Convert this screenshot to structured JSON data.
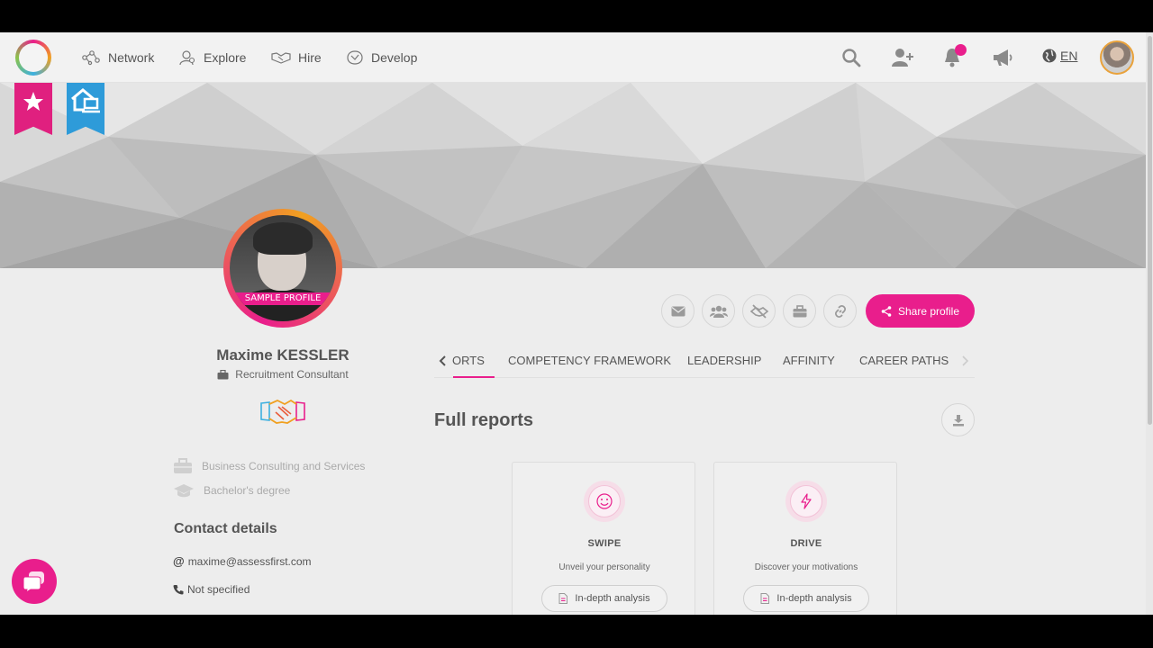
{
  "nav": {
    "items": [
      {
        "label": "Network",
        "icon": "network-icon"
      },
      {
        "label": "Explore",
        "icon": "explore-icon"
      },
      {
        "label": "Hire",
        "icon": "handshake-icon"
      },
      {
        "label": "Develop",
        "icon": "develop-icon"
      }
    ],
    "language": "EN",
    "right_icons": [
      "search-icon",
      "add-user-icon",
      "bell-icon",
      "megaphone-icon",
      "globe-icon"
    ]
  },
  "profile": {
    "sample_label": "SAMPLE PROFILE",
    "name": "Maxime KESSLER",
    "job_title": "Recruitment Consultant",
    "industry": "Business Consulting and Services",
    "education": "Bachelor's degree"
  },
  "contact": {
    "title": "Contact details",
    "email": "maxime@assessfirst.com",
    "phone": "Not specified"
  },
  "actions": {
    "share_label": "Share profile",
    "icons": [
      "mail-icon",
      "group-icon",
      "hide-icon",
      "briefcase-icon",
      "link-icon"
    ]
  },
  "tabs": {
    "items": [
      "ORTS",
      "COMPETENCY FRAMEWORK",
      "LEADERSHIP",
      "AFFINITY",
      "CAREER PATHS"
    ],
    "active": "ORTS"
  },
  "reports": {
    "title": "Full reports",
    "cards": [
      {
        "title": "SWIPE",
        "subtitle": "Unveil your personality",
        "button": "In-depth analysis",
        "icon": "smile-icon"
      },
      {
        "title": "DRIVE",
        "subtitle": "Discover your motivations",
        "button": "In-depth analysis",
        "icon": "lightning-icon"
      }
    ]
  },
  "colors": {
    "accent": "#e91e8c",
    "ribbon_blue": "#2e9bd9",
    "background": "#ededed"
  }
}
